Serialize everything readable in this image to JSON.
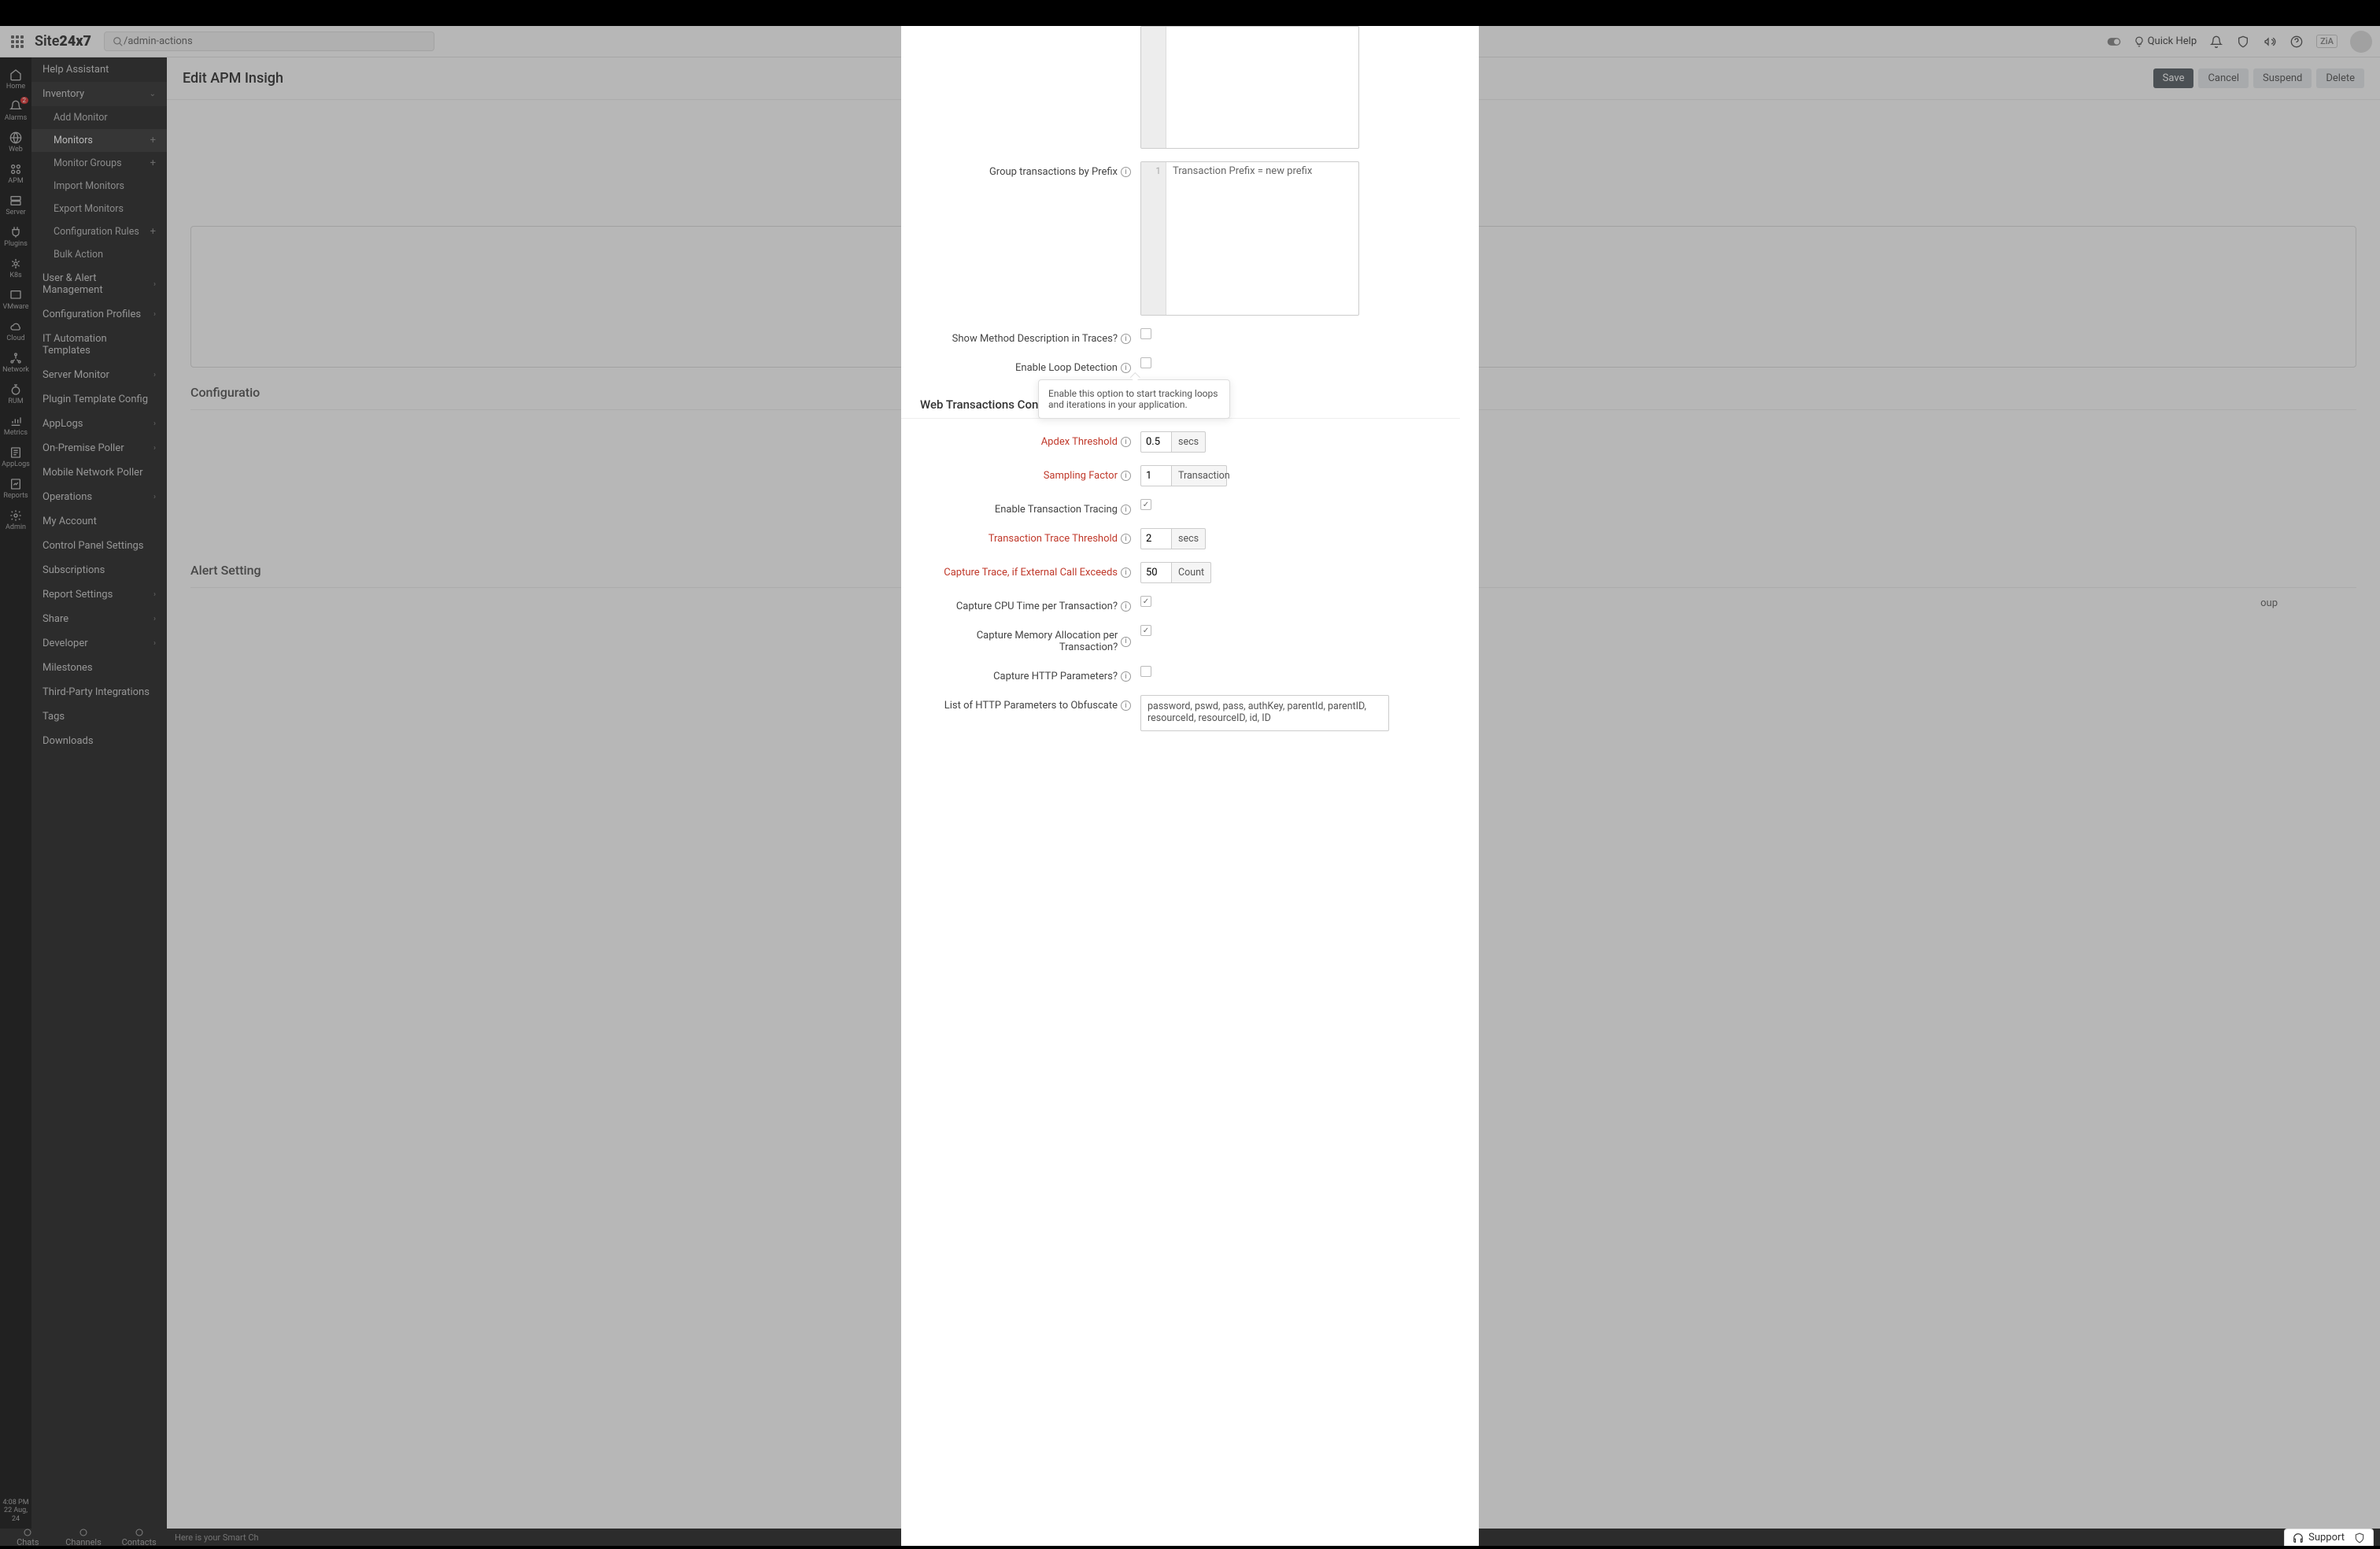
{
  "brand": {
    "a": "Site",
    "b": "24x7"
  },
  "search": {
    "value": "/admin-actions"
  },
  "top": {
    "quick_help": "Quick Help",
    "zia": "ZiA"
  },
  "rail_items": [
    {
      "label": "Home",
      "name": "home"
    },
    {
      "label": "Alarms",
      "name": "alarms",
      "badge": "2"
    },
    {
      "label": "Web",
      "name": "web"
    },
    {
      "label": "APM",
      "name": "apm"
    },
    {
      "label": "Server",
      "name": "server"
    },
    {
      "label": "Plugins",
      "name": "plugins"
    },
    {
      "label": "K8s",
      "name": "k8s"
    },
    {
      "label": "VMware",
      "name": "vmware"
    },
    {
      "label": "Cloud",
      "name": "cloud"
    },
    {
      "label": "Network",
      "name": "network"
    },
    {
      "label": "RUM",
      "name": "rum"
    },
    {
      "label": "Metrics",
      "name": "metrics"
    },
    {
      "label": "AppLogs",
      "name": "applogs"
    },
    {
      "label": "Reports",
      "name": "reports"
    },
    {
      "label": "Admin",
      "name": "admin"
    }
  ],
  "rail_time": {
    "t": "4:08 PM",
    "d": "22 Aug, 24"
  },
  "sidebar": {
    "help_assistant": "Help Assistant",
    "inventory": "Inventory",
    "inv_sub": [
      {
        "label": "Add Monitor",
        "plus": false
      },
      {
        "label": "Monitors",
        "plus": true,
        "active": true
      },
      {
        "label": "Monitor Groups",
        "plus": true
      },
      {
        "label": "Import Monitors",
        "plus": false
      },
      {
        "label": "Export Monitors",
        "plus": false
      },
      {
        "label": "Configuration Rules",
        "plus": true
      },
      {
        "label": "Bulk Action",
        "plus": false
      }
    ],
    "items": [
      {
        "label": "User & Alert Management",
        "chev": true
      },
      {
        "label": "Configuration Profiles",
        "chev": true
      },
      {
        "label": "IT Automation Templates",
        "chev": false
      },
      {
        "label": "Server Monitor",
        "chev": true
      },
      {
        "label": "Plugin Template Config",
        "chev": false
      },
      {
        "label": "AppLogs",
        "chev": true
      },
      {
        "label": "On-Premise Poller",
        "chev": true
      },
      {
        "label": "Mobile Network Poller",
        "chev": false
      },
      {
        "label": "Operations",
        "chev": true
      },
      {
        "label": "My Account",
        "chev": false
      },
      {
        "label": "Control Panel Settings",
        "chev": false
      },
      {
        "label": "Subscriptions",
        "chev": false
      },
      {
        "label": "Report Settings",
        "chev": true
      },
      {
        "label": "Share",
        "chev": true
      },
      {
        "label": "Developer",
        "chev": true
      },
      {
        "label": "Milestones",
        "chev": false
      },
      {
        "label": "Third-Party Integrations",
        "chev": false
      },
      {
        "label": "Tags",
        "chev": false
      },
      {
        "label": "Downloads",
        "chev": false
      }
    ]
  },
  "bottom": {
    "tabs": [
      "Chats",
      "Channels",
      "Contacts"
    ],
    "msg": "Here is your Smart Ch"
  },
  "page": {
    "title": "Edit APM Insigh",
    "save": "Save",
    "cancel": "Cancel",
    "suspend": "Suspend",
    "delete": "Delete",
    "bg_sections": [
      "Configuratio",
      "Alert Setting"
    ],
    "bg_group_suffix": "oup"
  },
  "modal": {
    "group_prefix_label": "Group transactions by Prefix",
    "group_prefix_placeholder": "Transaction Prefix = new prefix",
    "show_method_desc": "Show Method Description in Traces?",
    "enable_loop": "Enable Loop Detection",
    "tooltip_loop": "Enable this option to start tracking loops and iterations in your application.",
    "section_web_tx": "Web Transactions Config",
    "apdex_label": "Apdex Threshold",
    "apdex_val": "0.5",
    "apdex_unit": "secs",
    "sampling_label": "Sampling Factor",
    "sampling_val": "1",
    "sampling_unit": "Transaction",
    "enable_tx_trace": "Enable Transaction Tracing",
    "tx_trace_thresh_label": "Transaction Trace Threshold",
    "tx_trace_thresh_val": "2",
    "tx_trace_thresh_unit": "secs",
    "capture_ext_label": "Capture Trace, if External Call Exceeds",
    "capture_ext_val": "50",
    "capture_ext_unit": "Count",
    "capture_cpu": "Capture CPU Time per Transaction?",
    "capture_mem": "Capture Memory Allocation per Transaction?",
    "capture_http": "Capture HTTP Parameters?",
    "obfuscate_label": "List of HTTP Parameters to Obfuscate",
    "obfuscate_val": "password, pswd, pass, authKey, parentId, parentID, resourceId, resourceID, id, ID"
  },
  "support": "Support"
}
